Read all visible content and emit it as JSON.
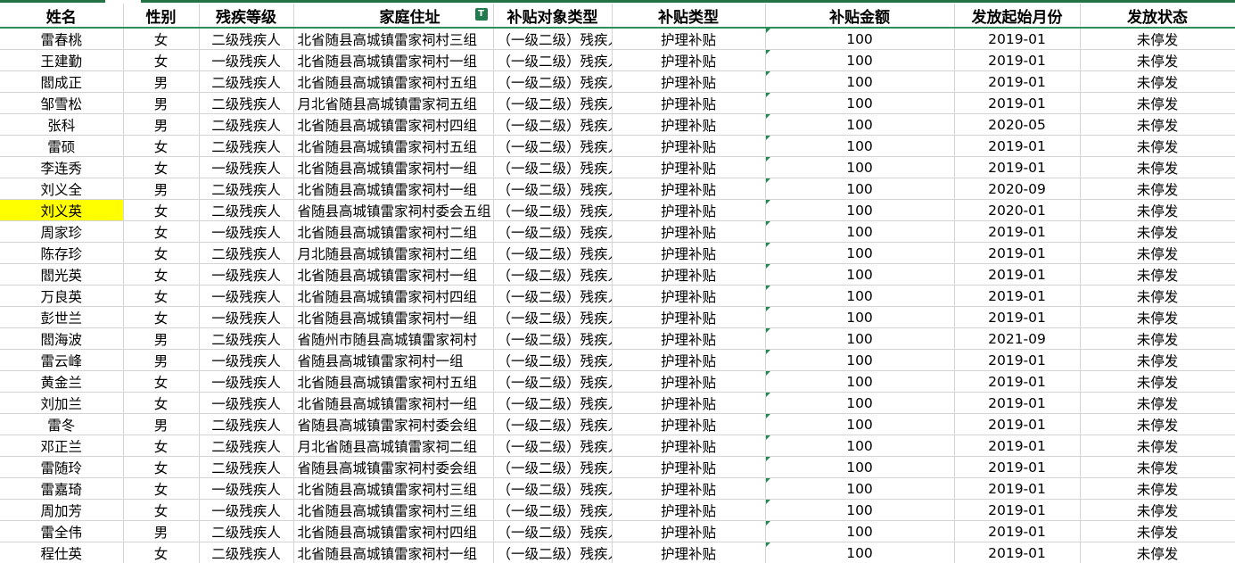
{
  "sheet": {
    "headers": [
      "姓名",
      "性别",
      "残疾等级",
      "家庭住址",
      "补贴对象类型",
      "补贴类型",
      "补贴金额",
      "发放起始月份",
      "发放状态"
    ],
    "filter_icon": "filter-active-icon",
    "highlight_color": "#ffff00",
    "rows": [
      [
        "雷春桃",
        "女",
        "二级残疾人",
        "北省随县高城镇雷家祠村三组",
        "（一级二级）残疾人",
        "护理补贴",
        "100",
        "2019-01",
        "未停发"
      ],
      [
        "王建勤",
        "女",
        "一级残疾人",
        "北省随县高城镇雷家祠村一组",
        "（一级二级）残疾人",
        "护理补贴",
        "100",
        "2019-01",
        "未停发"
      ],
      [
        "閻成正",
        "男",
        "二级残疾人",
        "北省随县高城镇雷家祠村五组",
        "（一级二级）残疾人",
        "护理补贴",
        "100",
        "2019-01",
        "未停发"
      ],
      [
        "邹雪松",
        "男",
        "二级残疾人",
        "月北省随县高城镇雷家祠五组",
        "（一级二级）残疾人",
        "护理补贴",
        "100",
        "2019-01",
        "未停发"
      ],
      [
        "张科",
        "男",
        "二级残疾人",
        "北省随县高城镇雷家祠村四组",
        "（一级二级）残疾人",
        "护理补贴",
        "100",
        "2020-05",
        "未停发"
      ],
      [
        "雷硕",
        "女",
        "二级残疾人",
        "北省随县高城镇雷家祠村五组",
        "（一级二级）残疾人",
        "护理补贴",
        "100",
        "2019-01",
        "未停发"
      ],
      [
        "李连秀",
        "女",
        "一级残疾人",
        "北省随县高城镇雷家祠村一组",
        "（一级二级）残疾人",
        "护理补贴",
        "100",
        "2019-01",
        "未停发"
      ],
      [
        "刘义全",
        "男",
        "二级残疾人",
        "北省随县高城镇雷家祠村一组",
        "（一级二级）残疾人",
        "护理补贴",
        "100",
        "2020-09",
        "未停发"
      ],
      [
        "刘义英",
        "女",
        "二级残疾人",
        "省随县高城镇雷家祠村委会五组",
        "（一级二级）残疾人",
        "护理补贴",
        "100",
        "2020-01",
        "未停发"
      ],
      [
        "周家珍",
        "女",
        "一级残疾人",
        "北省随县高城镇雷家祠村二组",
        "（一级二级）残疾人",
        "护理补贴",
        "100",
        "2019-01",
        "未停发"
      ],
      [
        "陈存珍",
        "女",
        "二级残疾人",
        "月北随县高城镇雷家祠村二组",
        "（一级二级）残疾人",
        "护理补贴",
        "100",
        "2019-01",
        "未停发"
      ],
      [
        "閻光英",
        "女",
        "一级残疾人",
        "北省随县高城镇雷家祠村一组",
        "（一级二级）残疾人",
        "护理补贴",
        "100",
        "2019-01",
        "未停发"
      ],
      [
        "万良英",
        "女",
        "一级残疾人",
        "北省随县高城镇雷家祠村四组",
        "（一级二级）残疾人",
        "护理补贴",
        "100",
        "2019-01",
        "未停发"
      ],
      [
        "彭世兰",
        "女",
        "一级残疾人",
        "北省随县高城镇雷家祠村一组",
        "（一级二级）残疾人",
        "护理补贴",
        "100",
        "2019-01",
        "未停发"
      ],
      [
        "閻海波",
        "男",
        "二级残疾人",
        "省随州市随县高城镇雷家祠村",
        "（一级二级）残疾人",
        "护理补贴",
        "100",
        "2021-09",
        "未停发"
      ],
      [
        "雷云峰",
        "男",
        "一级残疾人",
        "省随县高城镇雷家祠村一组",
        "（一级二级）残疾人",
        "护理补贴",
        "100",
        "2019-01",
        "未停发"
      ],
      [
        "黄金兰",
        "女",
        "一级残疾人",
        "北省随县高城镇雷家祠村五组",
        "（一级二级）残疾人",
        "护理补贴",
        "100",
        "2019-01",
        "未停发"
      ],
      [
        "刘加兰",
        "女",
        "一级残疾人",
        "北省随县高城镇雷家祠村一组",
        "（一级二级）残疾人",
        "护理补贴",
        "100",
        "2019-01",
        "未停发"
      ],
      [
        "雷冬",
        "男",
        "二级残疾人",
        "省随县高城镇雷家祠村委会组",
        "（一级二级）残疾人",
        "护理补贴",
        "100",
        "2019-01",
        "未停发"
      ],
      [
        "邓正兰",
        "女",
        "二级残疾人",
        "月北省随县高城镇雷家祠二组",
        "（一级二级）残疾人",
        "护理补贴",
        "100",
        "2019-01",
        "未停发"
      ],
      [
        "雷随玲",
        "女",
        "二级残疾人",
        "省随县高城镇雷家祠村委会组",
        "（一级二级）残疾人",
        "护理补贴",
        "100",
        "2019-01",
        "未停发"
      ],
      [
        "雷嘉琦",
        "女",
        "一级残疾人",
        "北省随县高城镇雷家祠村三组",
        "（一级二级）残疾人",
        "护理补贴",
        "100",
        "2019-01",
        "未停发"
      ],
      [
        "周加芳",
        "女",
        "一级残疾人",
        "北省随县高城镇雷家祠村三组",
        "（一级二级）残疾人",
        "护理补贴",
        "100",
        "2019-01",
        "未停发"
      ],
      [
        "雷全伟",
        "男",
        "二级残疾人",
        "北省随县高城镇雷家祠村四组",
        "（一级二级）残疾人",
        "护理补贴",
        "100",
        "2019-01",
        "未停发"
      ],
      [
        "程仕英",
        "女",
        "二级残疾人",
        "北省随县高城镇雷家祠村一组",
        "（一级二级）残疾人",
        "护理补贴",
        "100",
        "2019-01",
        "未停发"
      ]
    ],
    "highlighted_row": 8
  }
}
